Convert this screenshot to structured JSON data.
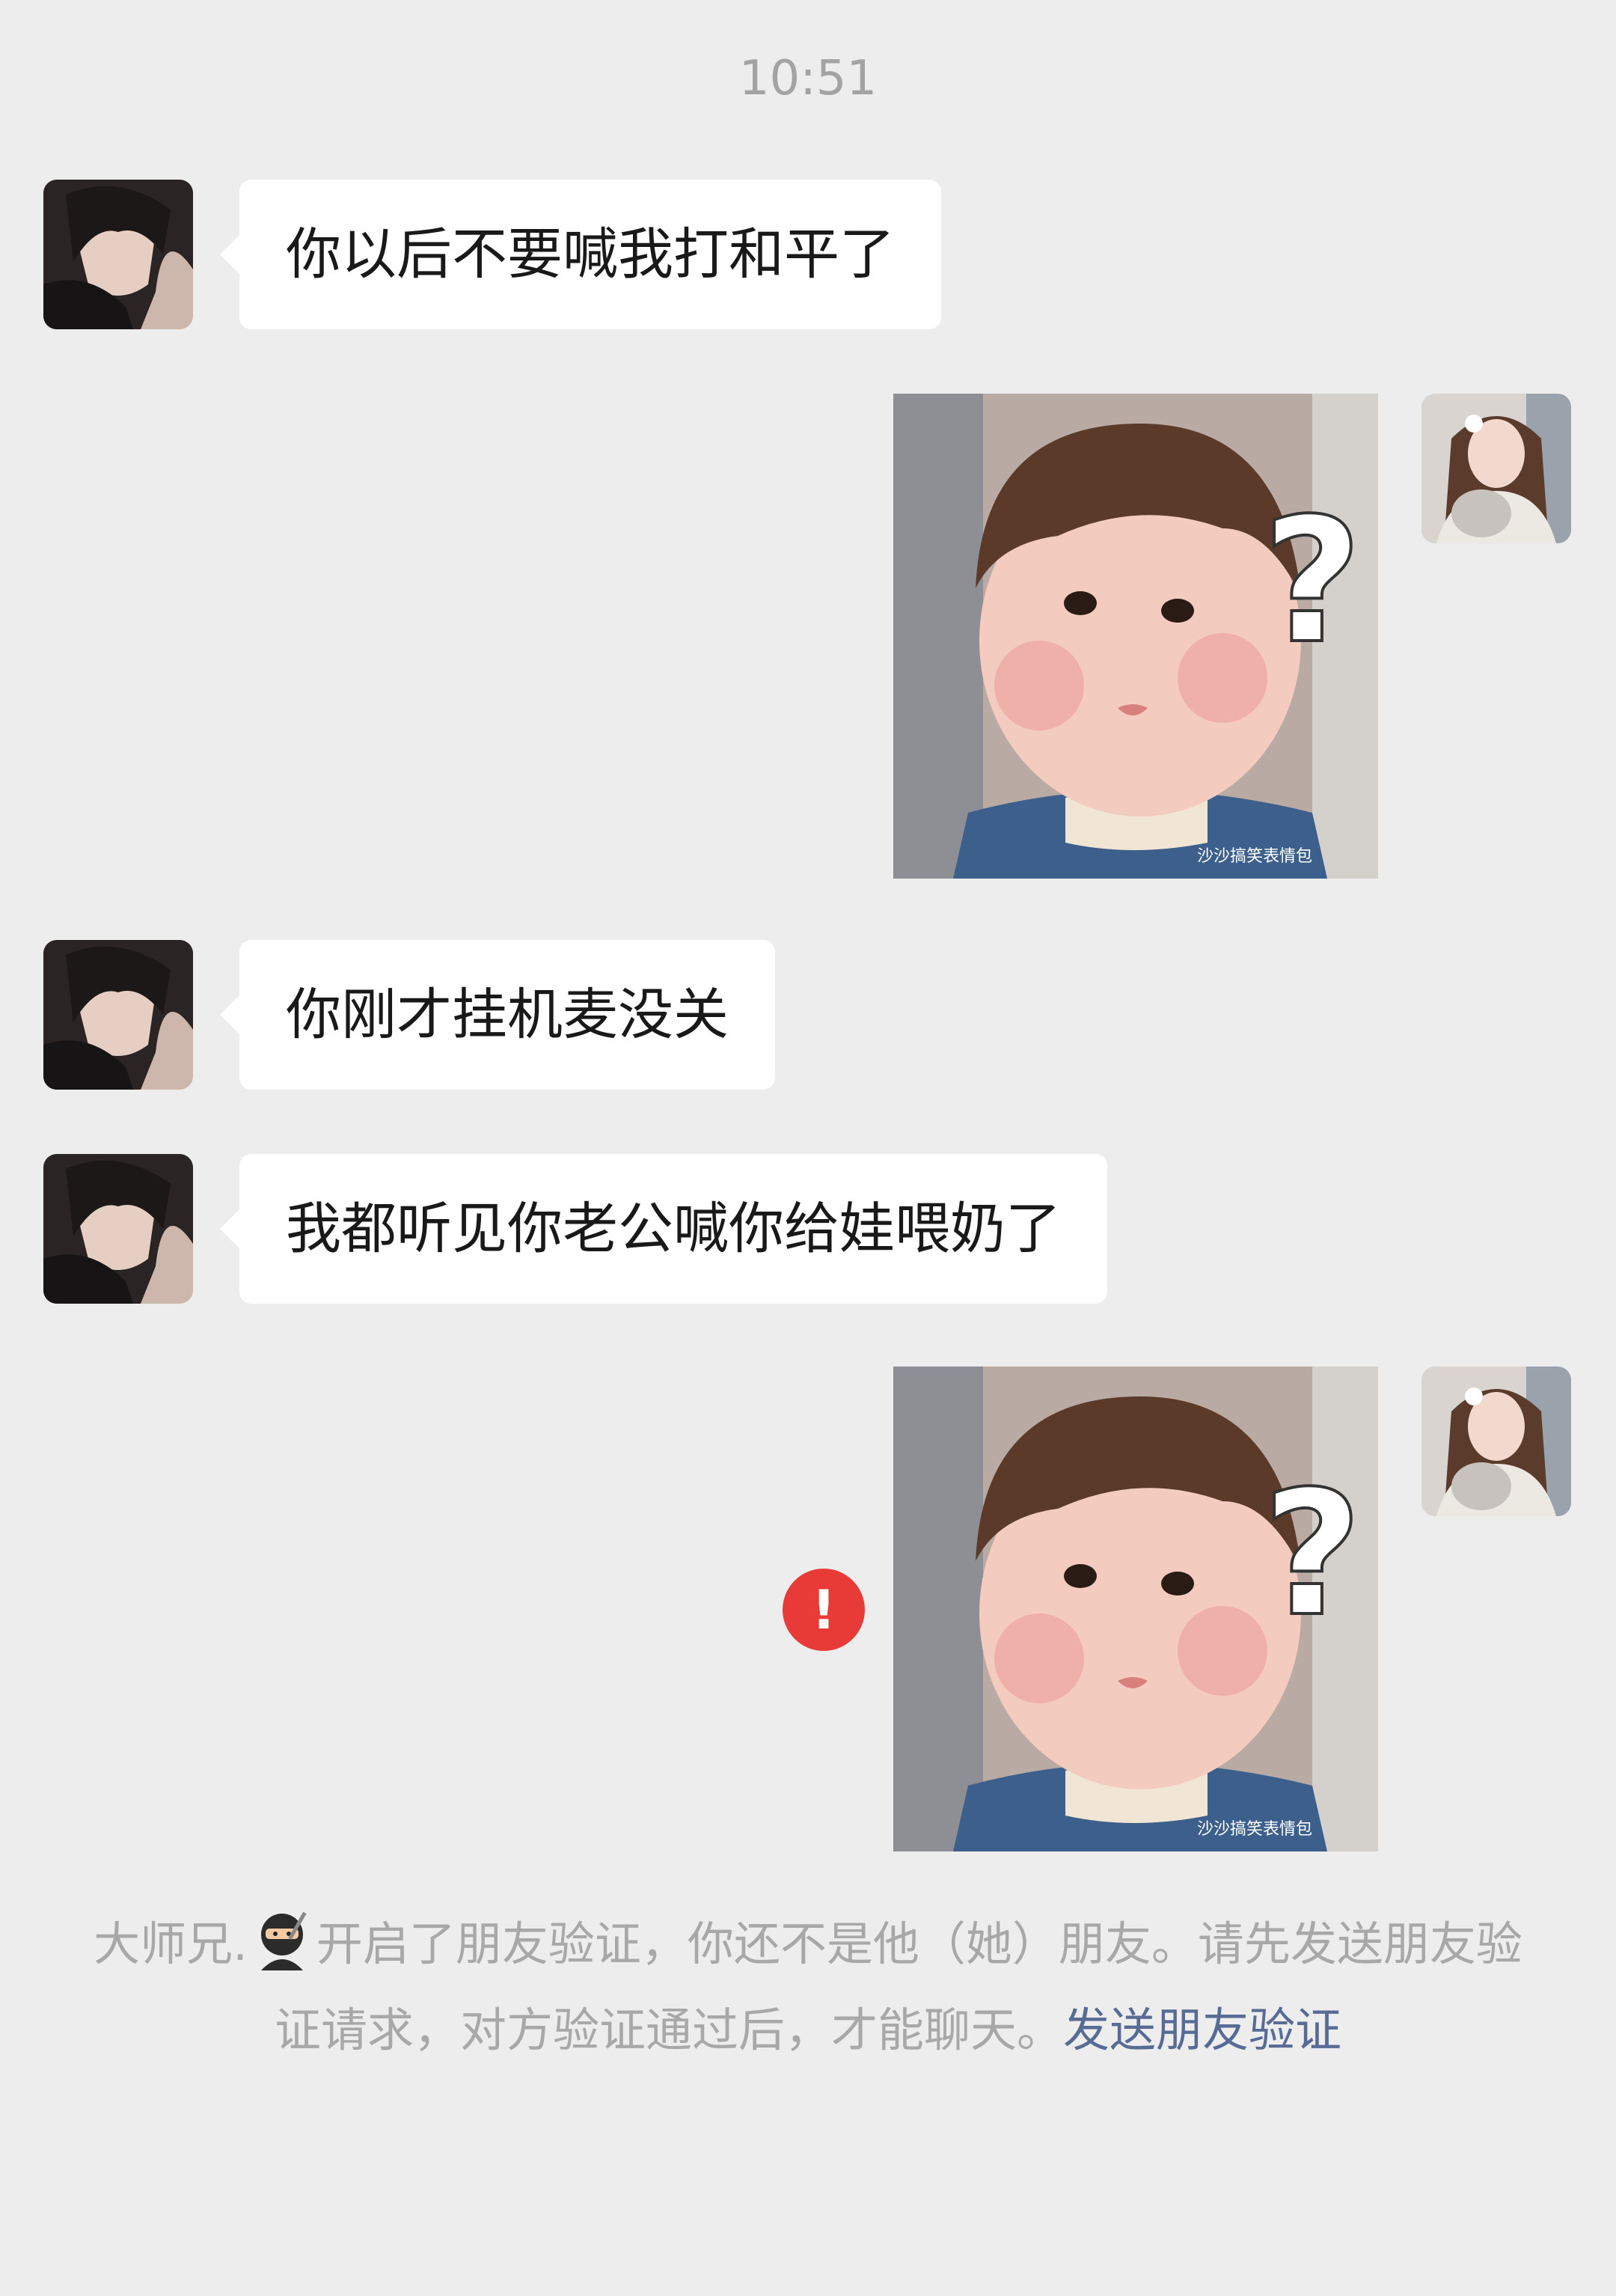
{
  "timestamp": "10:51",
  "messages": [
    {
      "side": "left",
      "type": "text",
      "text": "你以后不要喊我打和平了"
    },
    {
      "side": "right",
      "type": "sticker",
      "sticker_icon": "confused-baby-question-mark",
      "watermark": "沙沙搞笑表情包"
    },
    {
      "side": "left",
      "type": "text",
      "text": "你刚才挂机麦没关"
    },
    {
      "side": "left",
      "type": "text",
      "text": "我都听见你老公喊你给娃喂奶了"
    },
    {
      "side": "right",
      "type": "sticker",
      "sticker_icon": "confused-baby-question-mark",
      "watermark": "沙沙搞笑表情包",
      "send_failed": true,
      "error_symbol": "!"
    }
  ],
  "system_notice": {
    "name": "大师兄.",
    "name_icon": "ninja-emoji",
    "text": "开启了朋友验证，你还不是他（她）朋友。请先发送朋友验证请求，对方验证通过后，才能聊天。",
    "link": "发送朋友验证"
  },
  "colors": {
    "background": "#ededed",
    "bubble": "#ffffff",
    "error": "#e83a36",
    "link": "#576b95",
    "muted_text": "#a8a8a8"
  }
}
